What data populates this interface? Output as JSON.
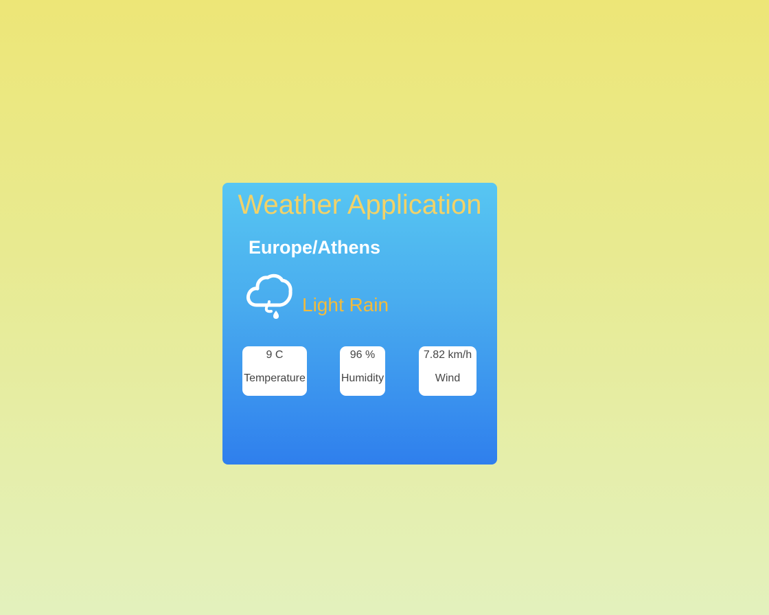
{
  "app": {
    "title": "Weather Application"
  },
  "location": {
    "timezone": "Europe/Athens"
  },
  "current": {
    "icon": "cloud-rain-icon",
    "condition": "Light Rain"
  },
  "stats": [
    {
      "value": "9 C",
      "label": "Temperature"
    },
    {
      "value": "96 %",
      "label": "Humidity"
    },
    {
      "value": "7.82 km/h",
      "label": "Wind"
    }
  ],
  "colors": {
    "title": "#f2d268",
    "condition": "#f2bb3c",
    "card_top": "#57c6f2",
    "card_bottom": "#2f7fed",
    "page_top": "#ede677",
    "page_bottom": "#e3f1bd"
  }
}
